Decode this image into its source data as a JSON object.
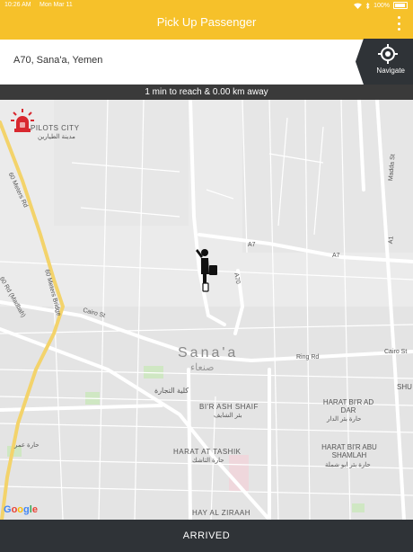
{
  "status_bar": {
    "time": "10:26 AM",
    "date": "Mon Mar 11",
    "battery": "100%"
  },
  "header": {
    "title": "Pick Up Passenger",
    "menu_icon": "more-vertical-icon"
  },
  "address": {
    "text": "A70, Sana'a, Yemen"
  },
  "navigate": {
    "label": "Navigate",
    "icon": "target-icon"
  },
  "eta": {
    "text": "1 min to reach & 0.00 km away"
  },
  "map": {
    "city_name": "Sana'a",
    "city_name_ar": "صنعاء",
    "labels": {
      "pilots_city": "PILOTS CITY",
      "pilots_city_ar": "مدينة الطيارين",
      "sixty_meters_rd": "60 Meters Rd",
      "sixty_meters_bridge": "60 Meters Bridge",
      "sixty_meters_rd_madbah": "60 Rd (Madbah)",
      "cairo_st": "Cairo St",
      "cairo_st_east": "Cairo St",
      "ring_rd": "Ring Rd",
      "bir_ash_shaif": "BI'R ASH SHAIF",
      "bir_ash_shaif_ar": "بئر الشايف",
      "harat_bir_ad_dar": "HARAT BI'R AD DAR",
      "harat_bir_ad_dar_ar": "حارة بئر الدار",
      "harat_at_tashik": "HARAT AT TASHIK",
      "harat_at_tashik_ar": "حارة التاشك",
      "harat_bir_abu_shamlah": "HARAT BI'R ABU SHAMLAH",
      "harat_bir_abu_shamlah_ar": "حارة بئر ابو شملة",
      "hay_al_ziraah": "HAY AL ZIRAAH",
      "shu": "SHU",
      "college": "كلية التجارة",
      "a7": "A7",
      "a7_b": "A7",
      "a70": "A70",
      "a1": "A1",
      "madda_st": "Madda St",
      "harat_omar": "حارة عمر"
    },
    "google": [
      "G",
      "o",
      "o",
      "g",
      "l",
      "e"
    ]
  },
  "footer": {
    "arrived_label": "ARRIVED"
  },
  "colors": {
    "accent": "#f6c12a",
    "dark": "#2f3337",
    "alarm": "#d8282f"
  }
}
